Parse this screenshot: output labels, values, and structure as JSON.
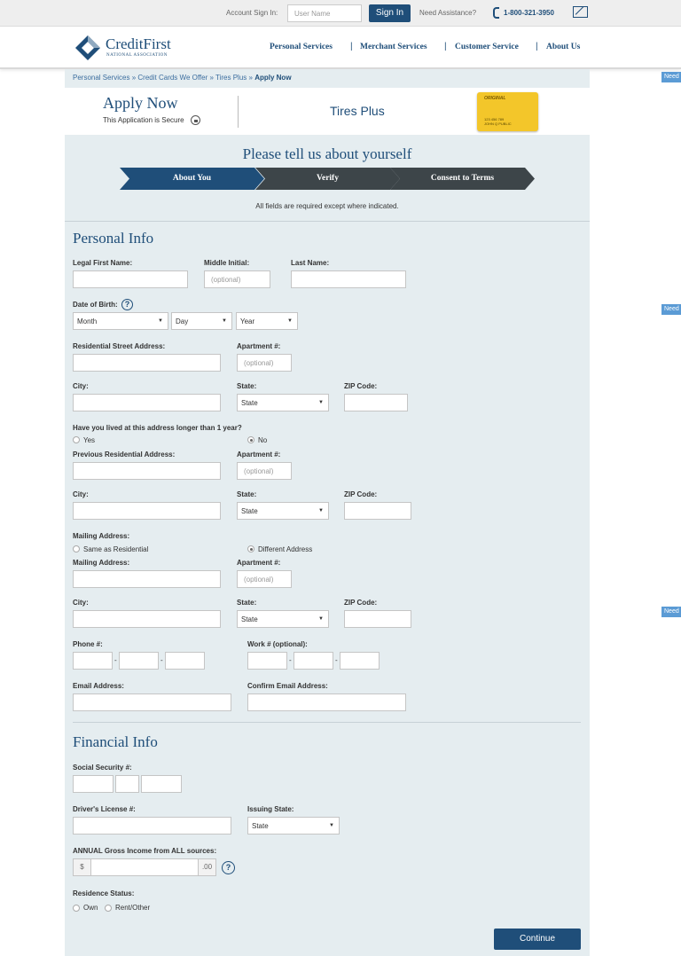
{
  "topbar": {
    "account_sign_in_label": "Account Sign In:",
    "username_placeholder": "User Name",
    "sign_in_button": "Sign In",
    "need_assistance": "Need Assistance?",
    "phone": "1-800-321-3950"
  },
  "header": {
    "logo_name": "CreditFirst",
    "logo_sub": "NATIONAL ASSOCIATION",
    "nav": [
      "Personal Services",
      "Merchant Services",
      "Customer Service",
      "About Us"
    ],
    "nav_separator": "|"
  },
  "breadcrumb": {
    "items": [
      "Personal Services",
      "Credit Cards We Offer",
      "Tires Plus"
    ],
    "separator": "»",
    "current": "Apply Now"
  },
  "apply": {
    "title": "Apply Now",
    "secure_text": "This Application is Secure",
    "merchant": "Tires Plus",
    "card_brand": "ORIGINAL",
    "card_number": "123 456 789",
    "card_name": "JOHN Q PUBLIC"
  },
  "steps": {
    "heading": "Please tell us about yourself",
    "items": [
      "About You",
      "Verify",
      "Consent to Terms"
    ],
    "active_index": 0,
    "required_note": "All fields are required except where indicated."
  },
  "personal": {
    "title": "Personal Info",
    "first_name_label": "Legal First Name:",
    "middle_initial_label": "Middle Initial:",
    "last_name_label": "Last Name:",
    "optional_placeholder": "(optional)",
    "dob_label": "Date of Birth:",
    "month": "Month",
    "day": "Day",
    "year": "Year",
    "street_label": "Residential Street Address:",
    "apartment_label": "Apartment #:",
    "city_label": "City:",
    "state_label": "State:",
    "zip_label": "ZIP Code:",
    "state_value": "State",
    "lived_question": "Have you lived at this address longer than 1 year?",
    "yes": "Yes",
    "no": "No",
    "prev_address_label": "Previous Residential Address:",
    "mailing_heading": "Mailing Address:",
    "same_as_residential": "Same as Residential",
    "different_address": "Different Address",
    "mailing_address_label": "Mailing Address:",
    "phone_label": "Phone #:",
    "work_label": "Work # (optional):",
    "dash": "-",
    "email_label": "Email Address:",
    "confirm_email_label": "Confirm Email Address:"
  },
  "financial": {
    "title": "Financial Info",
    "ssn_label": "Social Security #:",
    "license_label": "Driver's License #:",
    "issuing_state_label": "Issuing State:",
    "state_value": "State",
    "income_label": "ANNUAL Gross Income from ALL sources:",
    "currency": "$",
    "cents": ".00",
    "residence_label": "Residence Status:",
    "own": "Own",
    "rent": "Rent/Other"
  },
  "continue_button": "Continue",
  "side_tab": "Need Help?",
  "help_glyph": "?",
  "colors": {
    "brand_blue": "#1f4e79",
    "step_inactive": "#3d4549",
    "form_bg": "#e5edf0",
    "card_yellow": "#f3c62a"
  }
}
